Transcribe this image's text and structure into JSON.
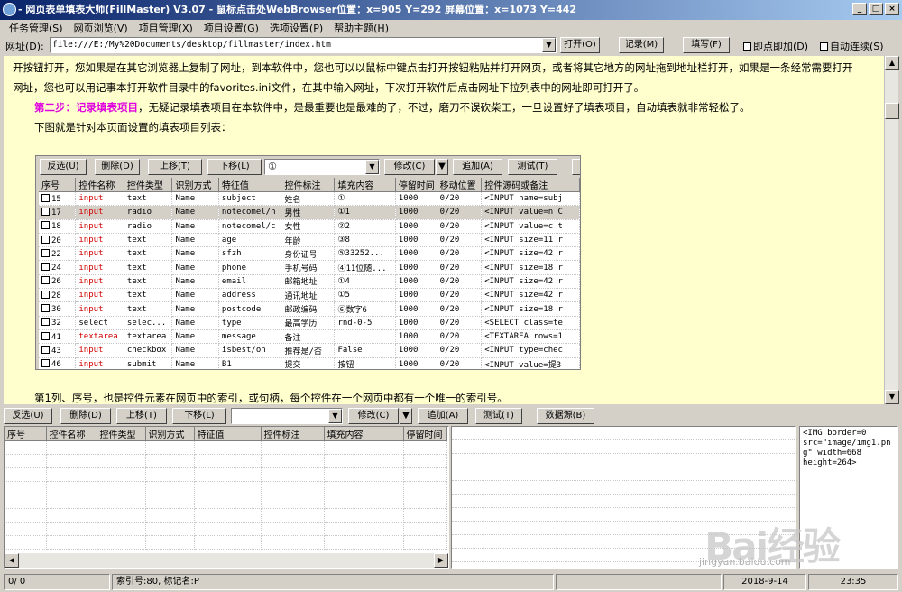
{
  "titlebar": {
    "title": " - 网页表单填表大师(FillMaster) V3.07 - 鼠标点击处WebBrowser位置：x=905 Y=292 屏幕位置：x=1073 Y=442"
  },
  "menu": [
    "任务管理(S)",
    "网页浏览(V)",
    "项目管理(X)",
    "项目设置(G)",
    "选项设置(P)",
    "帮助主题(H)"
  ],
  "urlbar": {
    "label": "网址(D):",
    "value": "file:///E:/My%20Documents/desktop/fillmaster/index.htm",
    "open_btn": "打开(O)",
    "record_btn": "记录(M)",
    "fill_btn": "填写(F)",
    "click_fill_label": "即点即加(D)",
    "auto_continue_label": "自动连续(S)"
  },
  "content": {
    "para1a": "开按钮打开，您如果是在其它浏览器上复制了网址，到本软件中，您也可以以鼠标中键点击打开按钮粘贴并打开网页，或者将其它地方的网址拖到地址栏打开，如果是一条经常需要打开",
    "para1b": "网址，您也可以用记事本打开软件目录中的favorites.ini文件，在其中输入网址，下次打开软件后点击网址下拉列表中的网址即可打开了。",
    "step2_label": "第二步：记录填表项目",
    "step2_text": "，无疑记录填表项目在本软件中，是最重要也是最难的了，不过，磨刀不误砍柴工，一旦设置好了填表项目，自动填表就非常轻松了。",
    "para3": "下图就是针对本页面设置的填表项目列表：",
    "para4": "第1列、序号，也是控件元素在网页中的索引，或句柄，每个控件在一个网页中都有一个唯一的索引号。"
  },
  "screenshot": {
    "toolbar": {
      "invert": "反选(U)",
      "delete": "删除(D)",
      "up": "上移(T)",
      "down": "下移(L)",
      "combo": "①",
      "modify": "修改(C)",
      "add": "追加(A)",
      "test": "测试(T)"
    },
    "columns": [
      "序号",
      "控件名称",
      "控件类型",
      "识别方式",
      "特征值",
      "控件标注",
      "填充内容",
      "停留时间",
      "移动位置",
      "控件源码或备注"
    ],
    "rows": [
      [
        "15",
        "input",
        "text",
        "Name",
        "subject",
        "姓名",
        "①",
        "1000",
        "0/20",
        "<INPUT name=subj"
      ],
      [
        "17",
        "input",
        "radio",
        "Name",
        "notecomel/n",
        "男性",
        "①1",
        "1000",
        "0/20",
        "<INPUT value=n C"
      ],
      [
        "18",
        "input",
        "radio",
        "Name",
        "notecomel/c",
        "女性",
        "②2",
        "1000",
        "0/20",
        "<INPUT value=c t"
      ],
      [
        "20",
        "input",
        "text",
        "Name",
        "age",
        "年龄",
        "③8",
        "1000",
        "0/20",
        "<INPUT size=11 r"
      ],
      [
        "22",
        "input",
        "text",
        "Name",
        "sfzh",
        "身份证号",
        "⑤33252...",
        "1000",
        "0/20",
        "<INPUT size=42 r"
      ],
      [
        "24",
        "input",
        "text",
        "Name",
        "phone",
        "手机号码",
        "④11位随...",
        "1000",
        "0/20",
        "<INPUT size=18 r"
      ],
      [
        "26",
        "input",
        "text",
        "Name",
        "email",
        "邮箱地址",
        "①4",
        "1000",
        "0/20",
        "<INPUT size=42 r"
      ],
      [
        "28",
        "input",
        "text",
        "Name",
        "address",
        "通讯地址",
        "①5",
        "1000",
        "0/20",
        "<INPUT size=42 r"
      ],
      [
        "30",
        "input",
        "text",
        "Name",
        "postcode",
        "邮政编码",
        "⑥数字6",
        "1000",
        "0/20",
        "<INPUT size=18 r"
      ],
      [
        "32",
        "select",
        "selec...",
        "Name",
        "type",
        "最高学历",
        "rnd-0-5",
        "1000",
        "0/20",
        "<SELECT class=te"
      ],
      [
        "41",
        "textarea",
        "textarea",
        "Name",
        "message",
        "备注",
        "",
        "1000",
        "0/20",
        "<TEXTAREA rows=1"
      ],
      [
        "43",
        "input",
        "checkbox",
        "Name",
        "isbest/on",
        "推荐是/否",
        "False",
        "1000",
        "0/20",
        "<INPUT type=chec"
      ],
      [
        "46",
        "input",
        "submit",
        "Name",
        "B1",
        "提交",
        "按钮",
        "1000",
        "0/20",
        "<INPUT value=提3"
      ]
    ]
  },
  "toolbar2": {
    "invert": "反选(U)",
    "delete": "删除(D)",
    "up": "上移(T)",
    "down": "下移(L)",
    "combo": "",
    "modify": "修改(C)",
    "add": "追加(A)",
    "test": "测试(T)",
    "datasource": "数据源(B)"
  },
  "bottom_grid": {
    "columns": [
      "序号",
      "控件名称",
      "控件类型",
      "识别方式",
      "特征值",
      "控件标注",
      "填充内容",
      "停留时间"
    ]
  },
  "source_panel": "<IMG border=0\nsrc=\"image/img1.png\" width=668\nheight=264>",
  "status": {
    "count": "0/ 0",
    "index": "索引号:80, 标记名:P",
    "date": "2018-9-14",
    "time": "23:35"
  },
  "watermark": {
    "logo": "Bai经验",
    "url": "jingyan.baidu.com"
  }
}
